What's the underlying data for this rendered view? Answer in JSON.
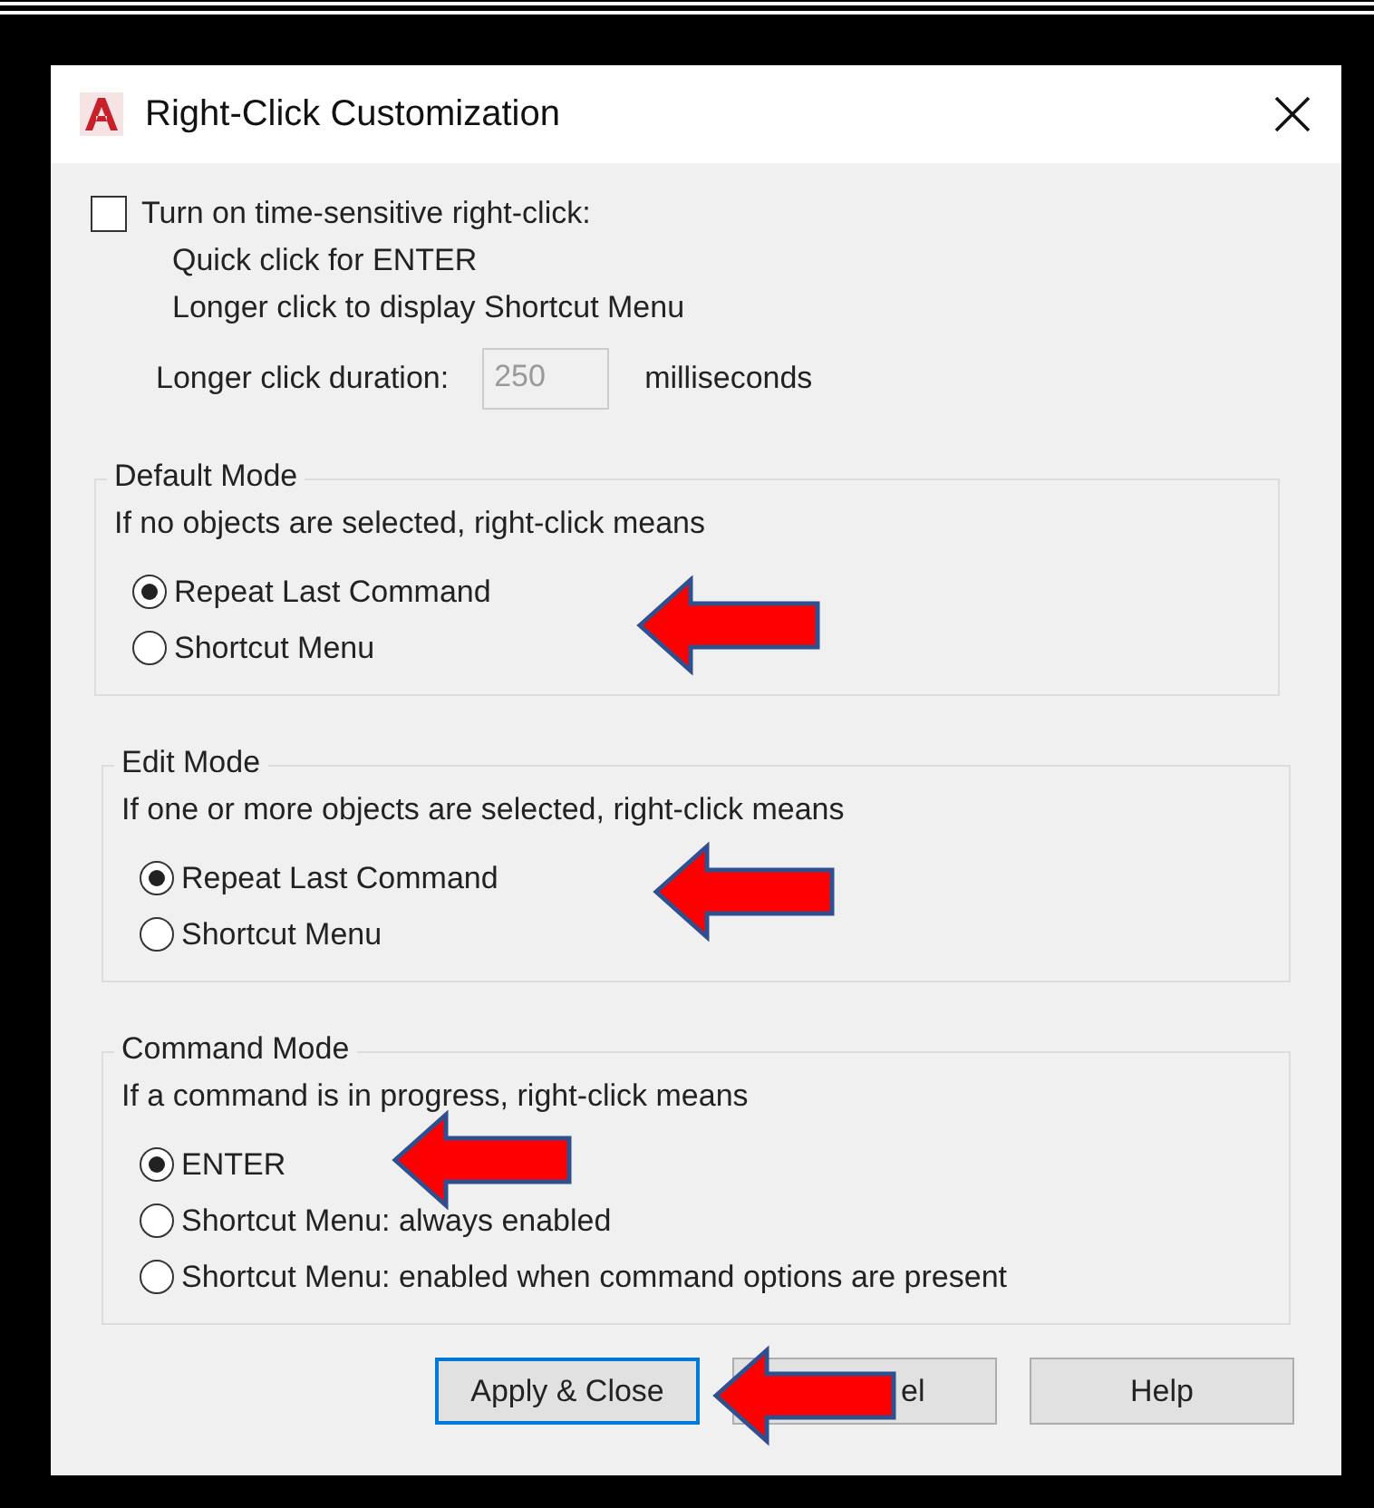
{
  "window": {
    "title": "Right-Click Customization"
  },
  "time_sensitive": {
    "label": "Turn on time-sensitive right-click:",
    "checked": false,
    "lines": [
      "Quick click for ENTER",
      "Longer click to display Shortcut Menu"
    ],
    "duration_label": "Longer click duration:",
    "duration_value": "250",
    "disabled": true,
    "units": "milliseconds"
  },
  "groups": [
    {
      "title": "Default Mode",
      "prompt": "If no objects are selected, right-click means",
      "options": [
        {
          "label": "Repeat Last Command",
          "selected": true
        },
        {
          "label": "Shortcut Menu",
          "selected": false
        }
      ]
    },
    {
      "title": "Edit Mode",
      "prompt": "If one or more objects are selected, right-click means",
      "options": [
        {
          "label": "Repeat Last Command",
          "selected": true
        },
        {
          "label": "Shortcut Menu",
          "selected": false
        }
      ]
    },
    {
      "title": "Command Mode",
      "prompt": "If a command is in progress, right-click means",
      "options": [
        {
          "label": "ENTER",
          "selected": true
        },
        {
          "label": "Shortcut Menu: always enabled",
          "selected": false
        },
        {
          "label": "Shortcut Menu: enabled when command options are present",
          "selected": false
        }
      ]
    }
  ],
  "buttons": [
    {
      "label": "Apply & Close",
      "focused": true,
      "kind": "apply"
    },
    {
      "label": "el",
      "focused": false,
      "kind": "cancel"
    },
    {
      "label": "Help",
      "focused": false,
      "kind": "help"
    }
  ]
}
